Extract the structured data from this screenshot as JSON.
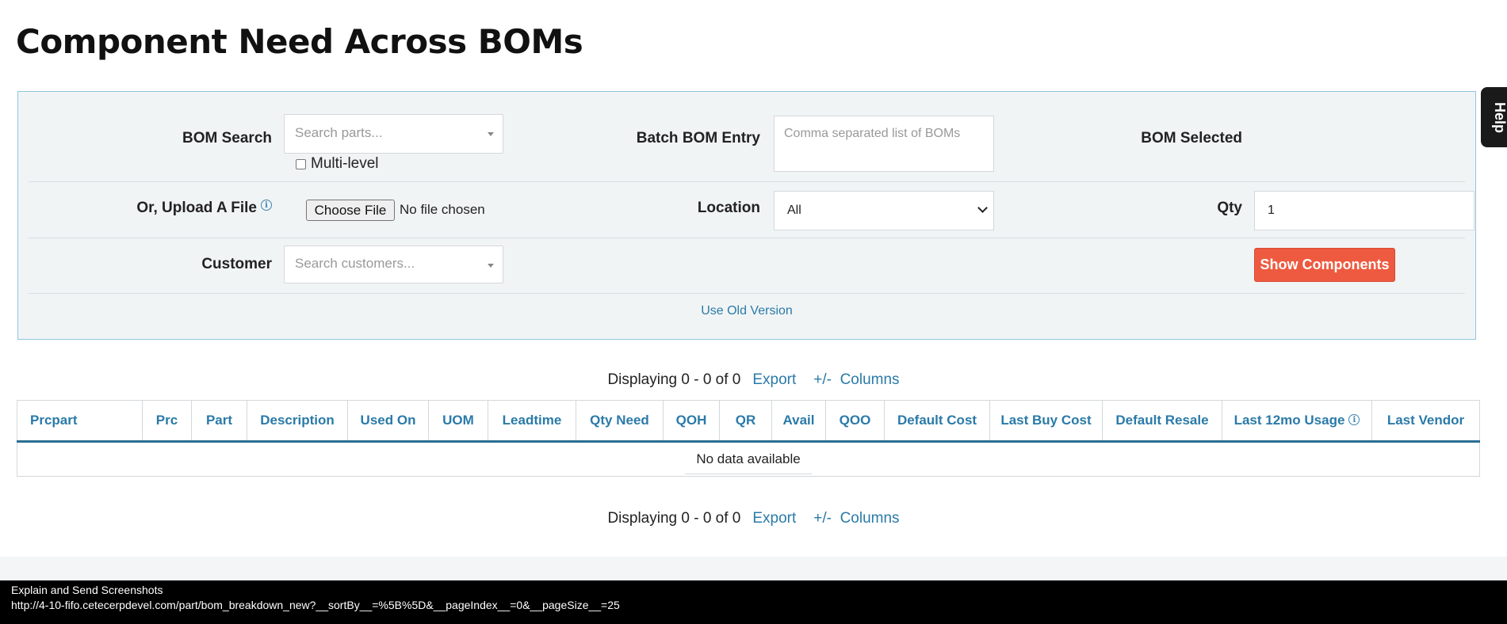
{
  "page": {
    "title": "Component Need Across BOMs"
  },
  "help": {
    "label": "Help"
  },
  "filters": {
    "bom_search": {
      "label": "BOM Search",
      "placeholder": "Search parts..."
    },
    "multi_level": {
      "label": "Multi-level",
      "checked": false
    },
    "batch_bom": {
      "label": "Batch BOM Entry",
      "placeholder": "Comma separated list of BOMs"
    },
    "bom_selected": {
      "label": "BOM Selected"
    },
    "upload": {
      "label": "Or, Upload A File",
      "button": "Choose File",
      "status": "No file chosen"
    },
    "location": {
      "label": "Location",
      "value": "All"
    },
    "qty": {
      "label": "Qty",
      "value": "1"
    },
    "customer": {
      "label": "Customer",
      "placeholder": "Search customers..."
    },
    "show_button": "Show Components",
    "old_version_link": "Use Old Version"
  },
  "pager": {
    "displaying": "Displaying 0 - 0 of 0",
    "export": "Export",
    "toggle": "+/-",
    "columns": "Columns"
  },
  "table": {
    "columns": [
      "Prcpart",
      "Prc",
      "Part",
      "Description",
      "Used On",
      "UOM",
      "Leadtime",
      "Qty Need",
      "QOH",
      "QR",
      "Avail",
      "QOO",
      "Default Cost",
      "Last Buy Cost",
      "Default Resale",
      "Last 12mo Usage",
      "Last Vendor"
    ],
    "empty_message": "No data available"
  },
  "status_bar": {
    "line1": "Explain and Send Screenshots",
    "line2": "http://4-10-fifo.cetecerpdevel.com/part/bom_breakdown_new?__sortBy__=%5B%5D&__pageIndex__=0&__pageSize__=25"
  },
  "colors": {
    "accent": "#2a7aa8",
    "primary_button": "#ee5a40",
    "panel_bg": "#f1f4f5",
    "panel_border": "#8fc6dc"
  }
}
